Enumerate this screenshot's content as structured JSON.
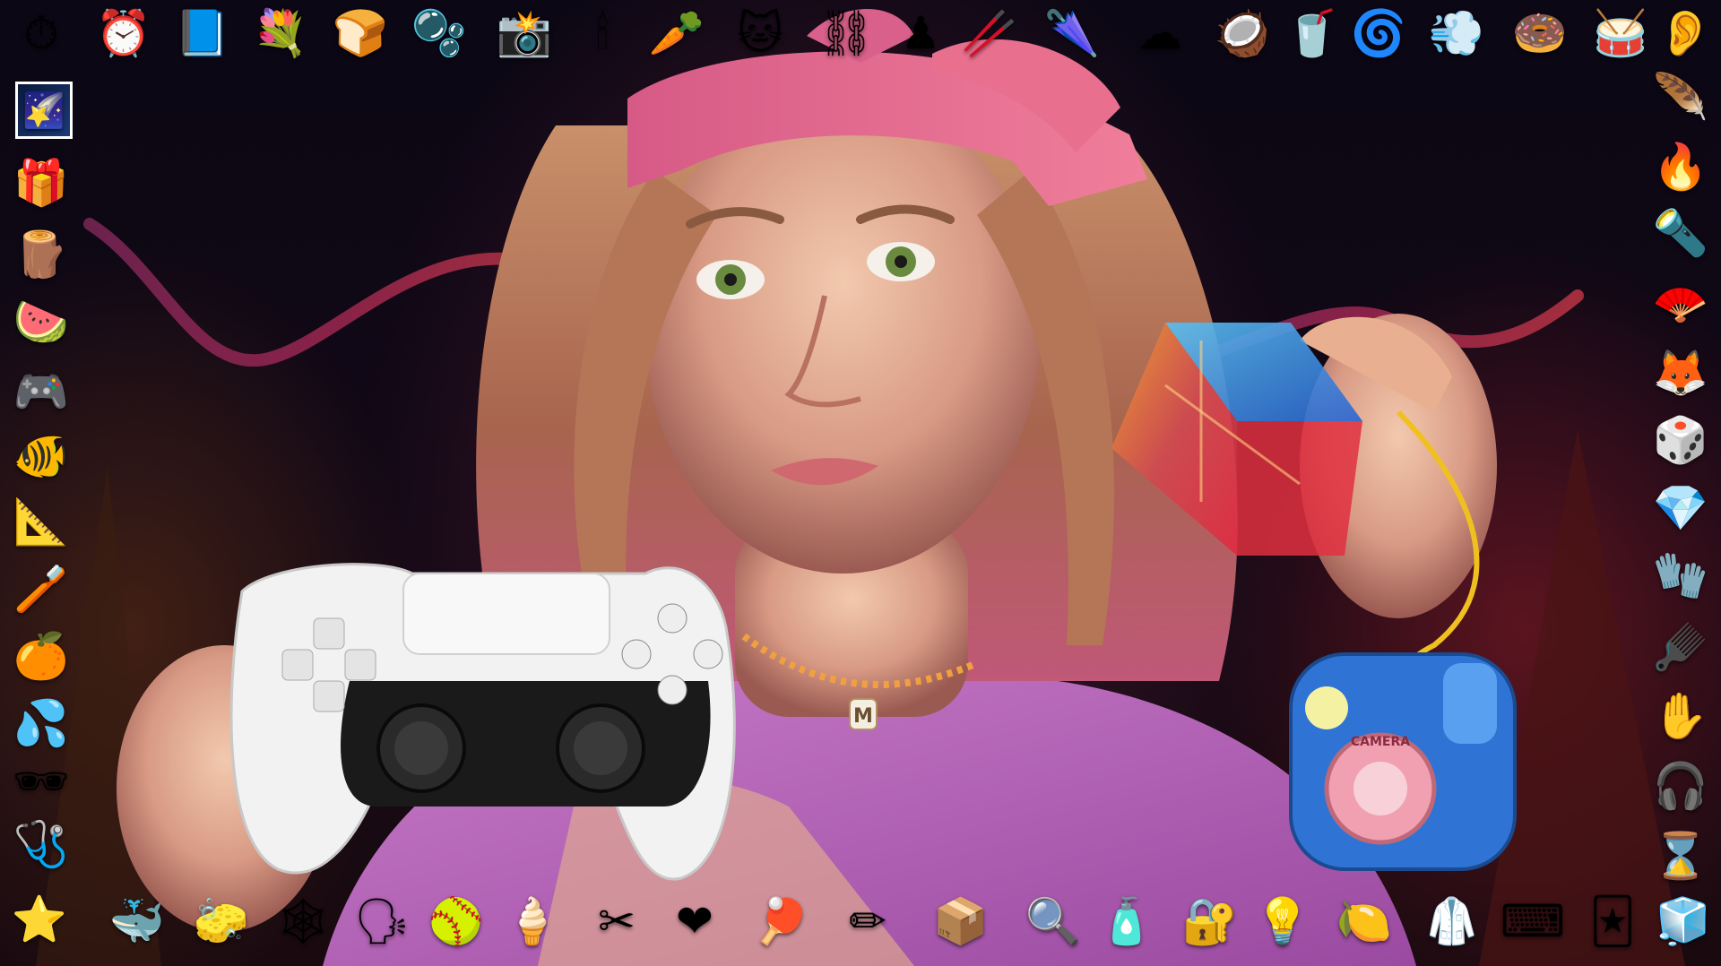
{
  "scene": {
    "subject": "woman with pink bandana holding game controller and glass cube",
    "accent_colors": {
      "bandana": "#e0607f",
      "neon_wave": "#b03070",
      "controller_white": "#f2f2f2",
      "controller_black": "#1a1a1a",
      "toy_camera_blue": "#2f74d4",
      "cube_orange": "#e88a2a",
      "cube_blue": "#2a8de0",
      "cube_red": "#d0302a"
    }
  },
  "pendant_letter": "M",
  "toy_camera_label": "CAMERA",
  "icons": {
    "top": [
      {
        "name": "stopwatch-icon",
        "glyph": "⏱"
      },
      {
        "name": "alarm-clock-icon",
        "glyph": "⏰"
      },
      {
        "name": "blue-book-icon",
        "glyph": "📘"
      },
      {
        "name": "bouquet-icon",
        "glyph": "💐"
      },
      {
        "name": "bread-icon",
        "glyph": "🍞"
      },
      {
        "name": "bubbles-icon",
        "glyph": "🫧"
      },
      {
        "name": "camera-flash-icon",
        "glyph": "📸"
      },
      {
        "name": "candle-icon",
        "glyph": "🕯"
      },
      {
        "name": "carrot-icon",
        "glyph": "🥕"
      },
      {
        "name": "cat-face-icon",
        "glyph": "🐱"
      },
      {
        "name": "chains-icon",
        "glyph": "⛓"
      },
      {
        "name": "chess-pawn-icon",
        "glyph": "♟"
      },
      {
        "name": "chopsticks-icon",
        "glyph": "🥢"
      },
      {
        "name": "closed-umbrella-icon",
        "glyph": "🌂"
      },
      {
        "name": "cloud-icon",
        "glyph": "☁"
      },
      {
        "name": "coconut-icon",
        "glyph": "🥥"
      },
      {
        "name": "cup-with-straw-icon",
        "glyph": "🥤"
      },
      {
        "name": "cyclone-icon",
        "glyph": "🌀"
      },
      {
        "name": "dashing-away-icon",
        "glyph": "💨"
      },
      {
        "name": "doughnut-icon",
        "glyph": "🍩"
      },
      {
        "name": "drum-icon",
        "glyph": "🥁"
      },
      {
        "name": "ear-icon",
        "glyph": "👂"
      }
    ],
    "left": [
      {
        "name": "shooting-star-icon",
        "glyph": "🌠"
      },
      {
        "name": "gift-icon",
        "glyph": "🎁"
      },
      {
        "name": "wood-icon",
        "glyph": "🪵"
      },
      {
        "name": "watermelon-icon",
        "glyph": "🍉"
      },
      {
        "name": "game-controller-icon",
        "glyph": "🎮"
      },
      {
        "name": "tropical-fish-icon",
        "glyph": "🐠"
      },
      {
        "name": "triangular-ruler-icon",
        "glyph": "📐"
      },
      {
        "name": "toothbrush-icon",
        "glyph": "🪥"
      },
      {
        "name": "tangerine-icon",
        "glyph": "🍊"
      },
      {
        "name": "sweat-droplets-icon",
        "glyph": "💦"
      },
      {
        "name": "sunglasses-icon",
        "glyph": "🕶"
      },
      {
        "name": "stethoscope-icon",
        "glyph": "🩺"
      },
      {
        "name": "star-icon",
        "glyph": "⭐"
      }
    ],
    "right": [
      {
        "name": "feather-icon",
        "glyph": "🪶"
      },
      {
        "name": "fire-icon",
        "glyph": "🔥"
      },
      {
        "name": "flashlight-icon",
        "glyph": "🔦"
      },
      {
        "name": "folding-fan-icon",
        "glyph": "🪭"
      },
      {
        "name": "fox-icon",
        "glyph": "🦊"
      },
      {
        "name": "game-die-icon",
        "glyph": "🎲"
      },
      {
        "name": "gem-stone-icon",
        "glyph": "💎"
      },
      {
        "name": "gloves-icon",
        "glyph": "🧤"
      },
      {
        "name": "hair-pick-icon",
        "glyph": "🪮"
      },
      {
        "name": "raised-hand-icon",
        "glyph": "✋"
      },
      {
        "name": "headphones-icon",
        "glyph": "🎧"
      },
      {
        "name": "hourglass-icon",
        "glyph": "⌛"
      }
    ],
    "bottom": [
      {
        "name": "whale-icon",
        "glyph": "🐳"
      },
      {
        "name": "sponge-icon",
        "glyph": "🧽"
      },
      {
        "name": "spider-web-icon",
        "glyph": "🕸"
      },
      {
        "name": "speaking-head-icon",
        "glyph": "🗣"
      },
      {
        "name": "softball-icon",
        "glyph": "🥎"
      },
      {
        "name": "soft-ice-cream-icon",
        "glyph": "🍦"
      },
      {
        "name": "scissors-icon",
        "glyph": "✂"
      },
      {
        "name": "red-heart-icon",
        "glyph": "❤"
      },
      {
        "name": "ping-pong-icon",
        "glyph": "🏓"
      },
      {
        "name": "pencil-icon",
        "glyph": "✏"
      },
      {
        "name": "package-icon",
        "glyph": "📦"
      },
      {
        "name": "magnifying-glass-icon",
        "glyph": "🔍"
      },
      {
        "name": "lotion-bottle-icon",
        "glyph": "🧴"
      },
      {
        "name": "locked-with-key-icon",
        "glyph": "🔐"
      },
      {
        "name": "light-bulb-icon",
        "glyph": "💡"
      },
      {
        "name": "lemon-icon",
        "glyph": "🍋"
      },
      {
        "name": "lab-coat-icon",
        "glyph": "🥼"
      },
      {
        "name": "keyboard-icon",
        "glyph": "⌨"
      },
      {
        "name": "joker-icon",
        "glyph": "🃏"
      },
      {
        "name": "ice-icon",
        "glyph": "🧊"
      }
    ]
  }
}
